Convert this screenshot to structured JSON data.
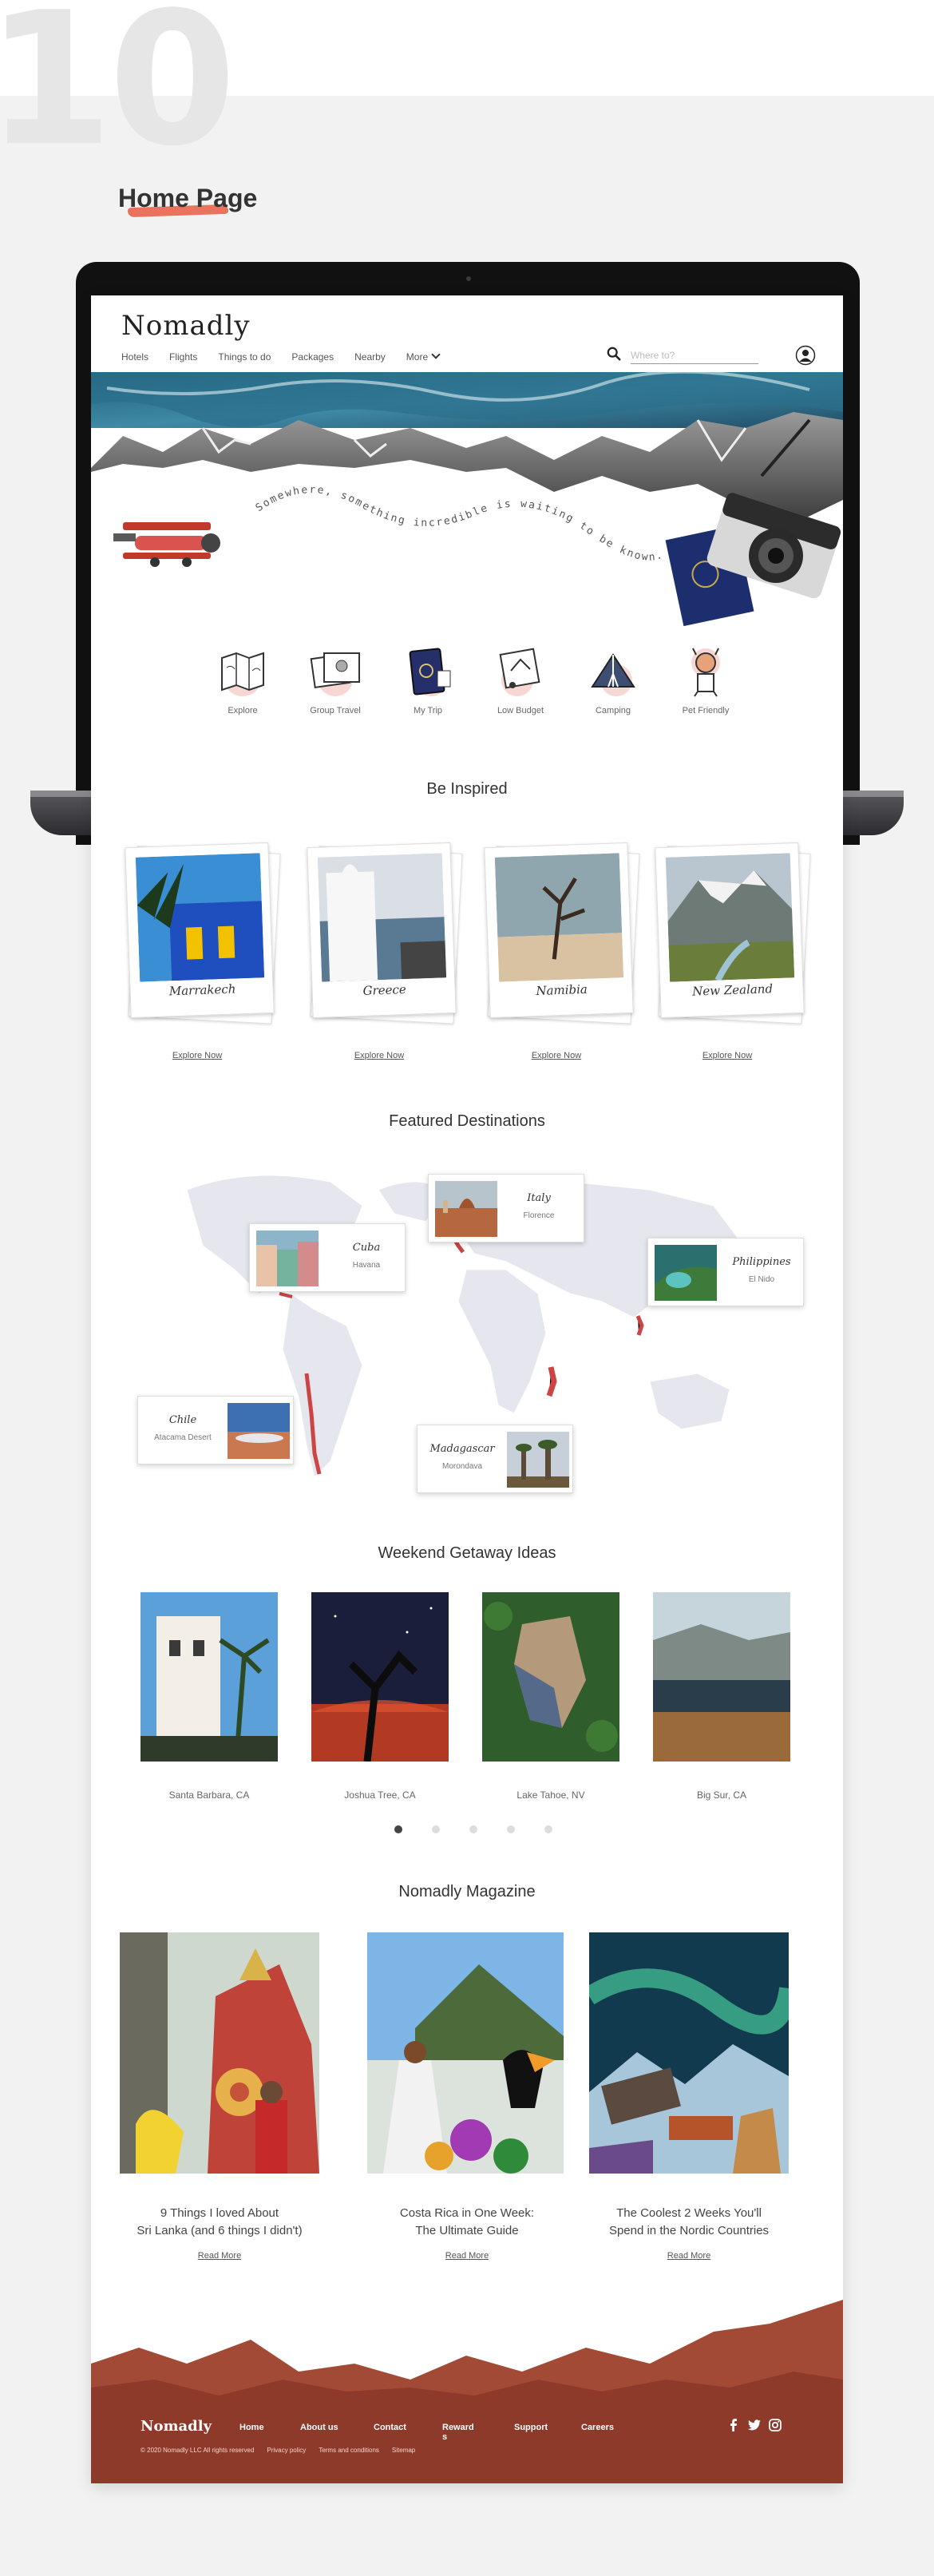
{
  "deck": {
    "number": "10",
    "section_title": "Home Page"
  },
  "app": {
    "logo": "Nomadly"
  },
  "nav": {
    "items": [
      "Hotels",
      "Flights",
      "Things to do",
      "Packages",
      "Nearby"
    ],
    "more_label": "More"
  },
  "search": {
    "placeholder": "Where to?"
  },
  "hero": {
    "tagline": "Somewhere, something incredible is waiting to be known..."
  },
  "categories": [
    {
      "label": "Explore",
      "icon": "map-icon"
    },
    {
      "label": "Group Travel",
      "icon": "photos-icon"
    },
    {
      "label": "My Trip",
      "icon": "passport-icon"
    },
    {
      "label": "Low Budget",
      "icon": "wallet-icon"
    },
    {
      "label": "Camping",
      "icon": "tent-icon"
    },
    {
      "label": "Pet Friendly",
      "icon": "dog-icon"
    }
  ],
  "inspired": {
    "title": "Be Inspired",
    "cards": [
      {
        "name": "Marrakech",
        "link": "Explore Now"
      },
      {
        "name": "Greece",
        "link": "Explore Now"
      },
      {
        "name": "Namibia",
        "link": "Explore Now"
      },
      {
        "name": "New Zealand",
        "link": "Explore Now"
      }
    ]
  },
  "featured": {
    "title": "Featured Destinations",
    "destinations": [
      {
        "country": "Cuba",
        "place": "Havana"
      },
      {
        "country": "Italy",
        "place": "Florence"
      },
      {
        "country": "Philippines",
        "place": "El Nido"
      },
      {
        "country": "Chile",
        "place": "Atacama Desert"
      },
      {
        "country": "Madagascar",
        "place": "Morondava"
      }
    ]
  },
  "getaway": {
    "title": "Weekend Getaway Ideas",
    "items": [
      "Santa Barbara, CA",
      "Joshua Tree, CA",
      "Lake Tahoe, NV",
      "Big Sur, CA"
    ],
    "active_page": 1,
    "pages": 5
  },
  "magazine": {
    "title": "Nomadly Magazine",
    "articles": [
      {
        "line1": "9 Things I loved About",
        "line2": "Sri Lanka (and 6 things I didn't)",
        "link": "Read More"
      },
      {
        "line1": "Costa Rica in One Week:",
        "line2": "The Ultimate Guide",
        "link": "Read More"
      },
      {
        "line1": "The Coolest 2 Weeks You'll",
        "line2": "Spend in the Nordic Countries",
        "link": "Read More"
      }
    ]
  },
  "footer": {
    "logo": "Nomadly",
    "nav": [
      "Home",
      "About us",
      "Contact",
      "Rewards",
      "Support",
      "Careers"
    ],
    "copyright": "© 2020 Nomadly LLC All rights reserved",
    "legal": [
      "Privacy policy",
      "Terms and conditions",
      "Sitemap"
    ],
    "social": [
      "facebook-icon",
      "twitter-icon",
      "instagram-icon"
    ]
  },
  "colors": {
    "accent": "#e8654b",
    "footer": "#8e3a2a"
  }
}
